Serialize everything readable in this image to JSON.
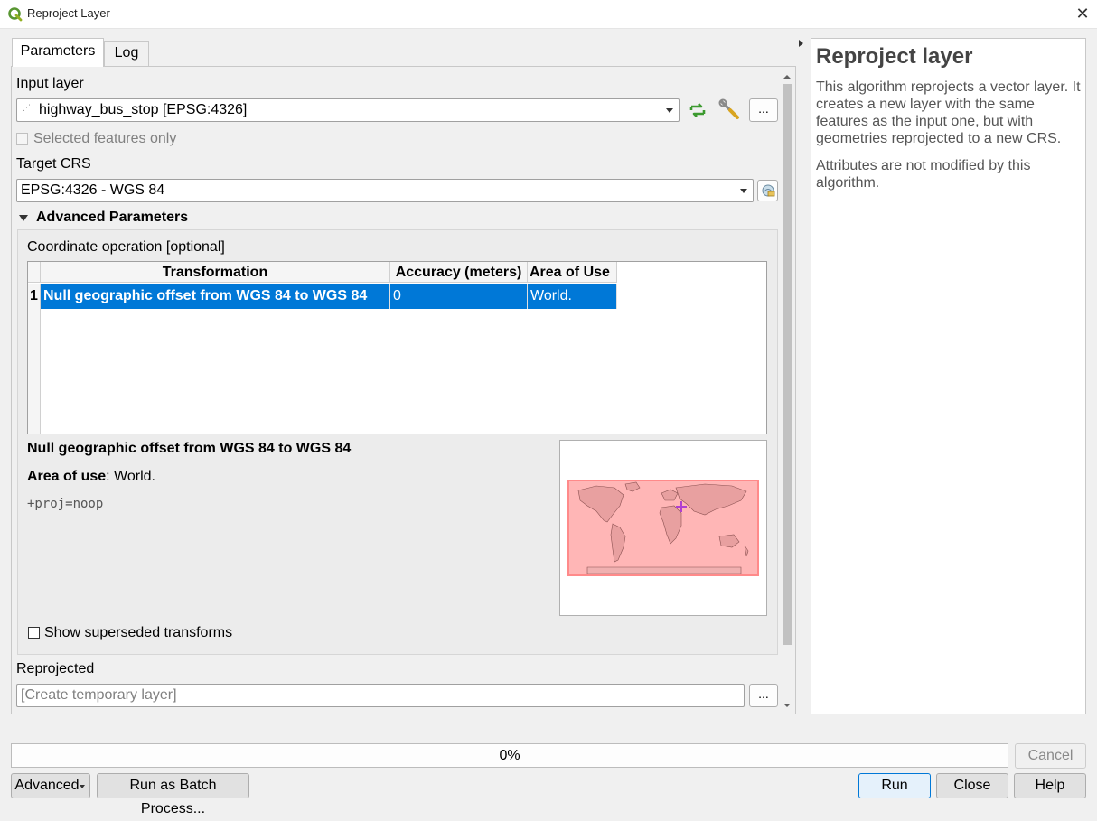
{
  "window": {
    "title": "Reproject Layer",
    "close_icon": "close-icon"
  },
  "tabs": [
    {
      "label": "Parameters",
      "active": true
    },
    {
      "label": "Log",
      "active": false
    }
  ],
  "params": {
    "input_layer_label": "Input layer",
    "input_layer_value": "highway_bus_stop [EPSG:4326]",
    "selected_only_label": "Selected features only",
    "selected_only_checked": false,
    "target_crs_label": "Target CRS",
    "target_crs_value": "EPSG:4326 - WGS 84",
    "ellipsis": "...",
    "advanced_label": "Advanced Parameters",
    "coord_op_label": "Coordinate operation [optional]",
    "reprojected_label": "Reprojected",
    "reprojected_placeholder": "[Create temporary layer]"
  },
  "table": {
    "headers": [
      "Transformation",
      "Accuracy (meters)",
      "Area of Use"
    ],
    "rows": [
      {
        "num": "1",
        "transformation": "Null geographic offset from WGS 84 to WGS 84",
        "accuracy": "0",
        "area": "World."
      }
    ],
    "selected_color": "#0078d7"
  },
  "details": {
    "title": "Null geographic offset from WGS 84 to WGS 84",
    "area_label": "Area of use",
    "area_value": ": World.",
    "proj": "+proj=noop",
    "show_superseded_label": "Show superseded transforms",
    "show_superseded_checked": false
  },
  "help": {
    "title": "Reproject layer",
    "p1": "This algorithm reprojects a vector layer. It creates a new layer with the same features as the input one, but with geometries reprojected to a new CRS.",
    "p2": "Attributes are not modified by this algorithm."
  },
  "bottom": {
    "progress_percent": 0,
    "progress_text": "0%",
    "cancel": "Cancel",
    "advanced": "Advanced",
    "batch": "Run as Batch Process...",
    "run": "Run",
    "close": "Close",
    "help": "Help"
  },
  "colors": {
    "accent": "#0078d7",
    "map_fill": "#ffb3b3",
    "map_border": "#ff8080"
  }
}
